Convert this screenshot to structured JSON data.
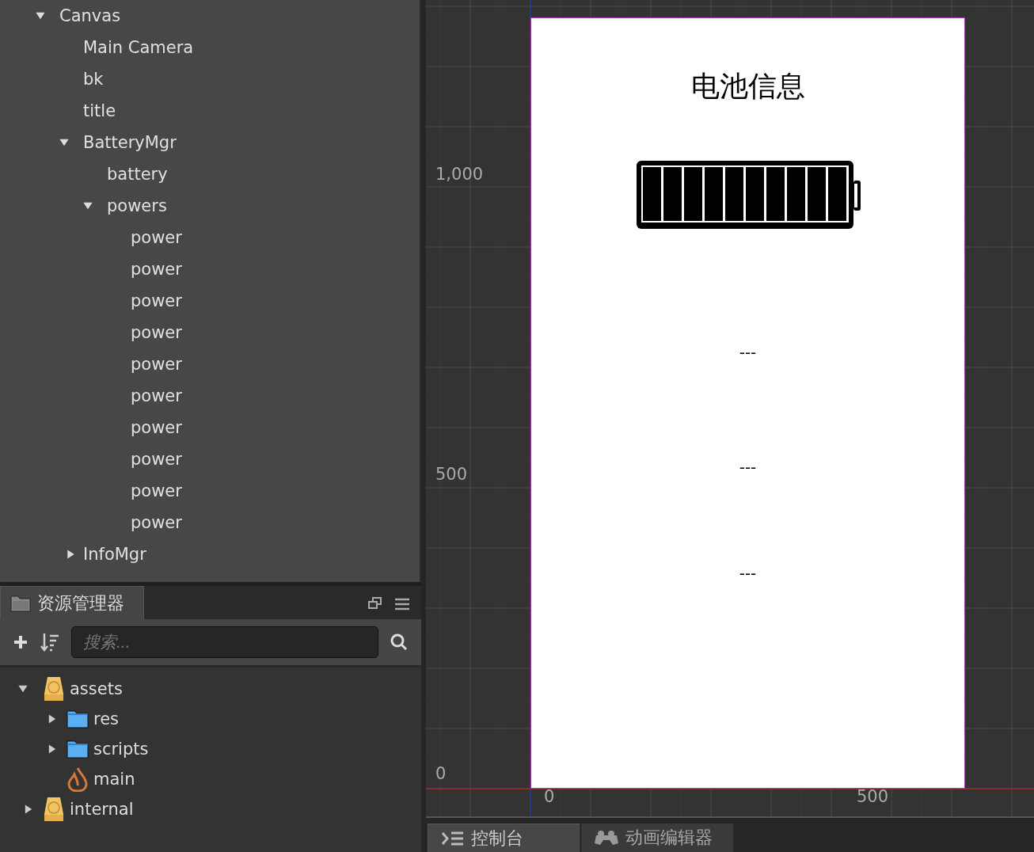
{
  "hierarchy": [
    {
      "label": "Canvas",
      "expanded": true,
      "children": [
        {
          "label": "Main Camera"
        },
        {
          "label": "bk"
        },
        {
          "label": "title"
        },
        {
          "label": "BatteryMgr",
          "expanded": true,
          "children": [
            {
              "label": "battery"
            },
            {
              "label": "powers",
              "expanded": true,
              "children": [
                {
                  "label": "power"
                },
                {
                  "label": "power"
                },
                {
                  "label": "power"
                },
                {
                  "label": "power"
                },
                {
                  "label": "power"
                },
                {
                  "label": "power"
                },
                {
                  "label": "power"
                },
                {
                  "label": "power"
                },
                {
                  "label": "power"
                },
                {
                  "label": "power"
                }
              ]
            }
          ]
        },
        {
          "label": "InfoMgr",
          "expanded": false
        }
      ]
    }
  ],
  "assets_panel": {
    "tab": {
      "label": "资源管理器",
      "selected": true
    },
    "search": {
      "placeholder": "搜索..."
    },
    "tree": [
      {
        "label": "assets",
        "kind": "database",
        "expanded": true,
        "children": [
          {
            "label": "res",
            "kind": "folder",
            "expanded": false
          },
          {
            "label": "scripts",
            "kind": "folder",
            "expanded": false
          },
          {
            "label": "main",
            "kind": "scene"
          }
        ]
      },
      {
        "label": "internal",
        "kind": "database",
        "expanded": false
      }
    ]
  },
  "scene": {
    "y_labels": [
      "1,000",
      "500",
      "0"
    ],
    "x_labels": [
      "0",
      "500"
    ],
    "canvas": {
      "title": "电池信息",
      "info_lines": [
        "---",
        "---",
        "---"
      ]
    }
  },
  "bottom_tabs": [
    {
      "label": "控制台",
      "selected": true
    },
    {
      "label": "动画编辑器",
      "selected": false
    }
  ]
}
